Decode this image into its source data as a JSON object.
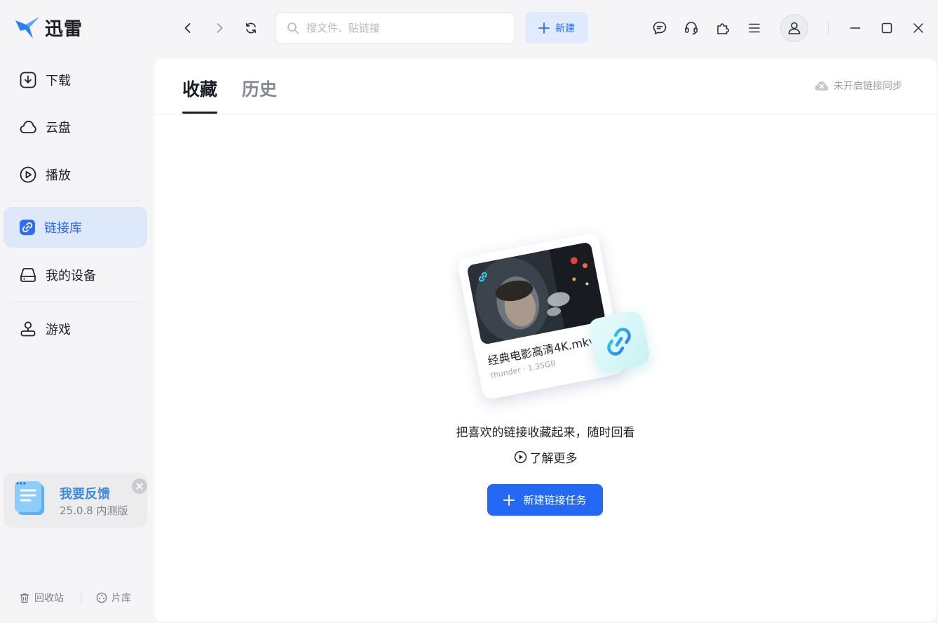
{
  "app": {
    "name": "迅雷"
  },
  "toolbar": {
    "search_placeholder": "搜文件、贴链接",
    "new_label": "新建",
    "icons": [
      "chevron-left-icon",
      "chevron-right-icon",
      "refresh-icon",
      "message-icon",
      "headset-icon",
      "puzzle-icon",
      "menu-icon",
      "user-icon",
      "minimize-icon",
      "maximize-icon",
      "close-icon"
    ]
  },
  "sidebar": {
    "items": [
      {
        "label": "下载",
        "icon": "download-icon",
        "active": false
      },
      {
        "label": "云盘",
        "icon": "cloud-icon",
        "active": false
      },
      {
        "label": "播放",
        "icon": "play-circle-icon",
        "active": false
      },
      {
        "label": "链接库",
        "icon": "link-icon",
        "active": true
      },
      {
        "label": "我的设备",
        "icon": "device-icon",
        "active": false
      },
      {
        "label": "游戏",
        "icon": "joystick-icon",
        "active": false
      }
    ],
    "feedback": {
      "title": "我要反馈",
      "version": "25.0.8 内测版"
    },
    "bottom": {
      "trash": "回收站",
      "library": "片库"
    }
  },
  "main": {
    "tabs": [
      {
        "label": "收藏",
        "active": true
      },
      {
        "label": "历史",
        "active": false
      }
    ],
    "sync_status": "未开启链接同步",
    "empty": {
      "card_title": "经典电影高清4K.mkv",
      "card_meta": "thunder · 1.35GB",
      "message": "把喜欢的链接收藏起来，随时回看",
      "learn_more": "了解更多",
      "action": "新建链接任务"
    }
  },
  "colors": {
    "accent": "#2469f3",
    "active_bg": "#dde8fb",
    "feedback_title": "#3d8ad8"
  }
}
